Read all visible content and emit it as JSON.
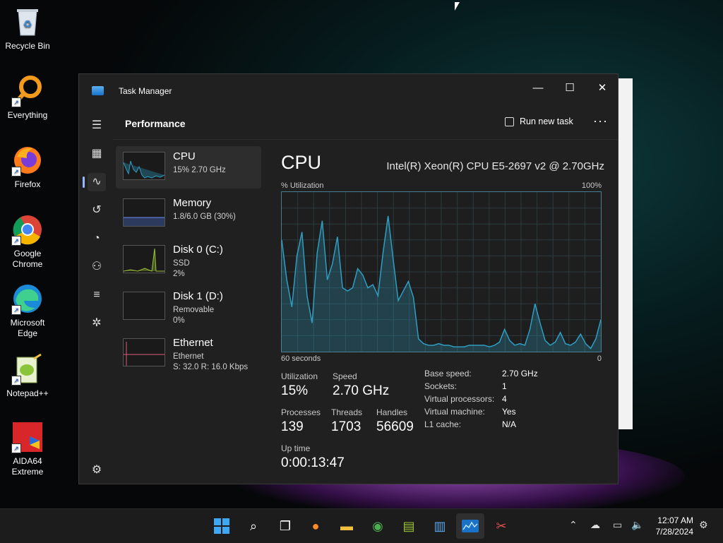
{
  "desktop": {
    "icons": [
      {
        "label": "Recycle Bin"
      },
      {
        "label": "Everything"
      },
      {
        "label": "Firefox"
      },
      {
        "label": "Google Chrome"
      },
      {
        "label": "Microsoft Edge"
      },
      {
        "label": "Notepad++"
      },
      {
        "label": "AIDA64 Extreme"
      }
    ]
  },
  "window": {
    "title": "Task Manager",
    "controls": {
      "minimize": "—",
      "maximize": "☐",
      "close": "✕"
    }
  },
  "header": {
    "page_title": "Performance",
    "run_new_task": "Run new task",
    "more": "···"
  },
  "resources": [
    {
      "name": "CPU",
      "sub1": "15%  2.70 GHz",
      "sub2": ""
    },
    {
      "name": "Memory",
      "sub1": "1.8/6.0 GB (30%)",
      "sub2": ""
    },
    {
      "name": "Disk 0 (C:)",
      "sub1": "SSD",
      "sub2": "2%"
    },
    {
      "name": "Disk 1 (D:)",
      "sub1": "Removable",
      "sub2": "0%"
    },
    {
      "name": "Ethernet",
      "sub1": "Ethernet",
      "sub2": "S: 32.0  R: 16.0 Kbps"
    }
  ],
  "detail": {
    "title": "CPU",
    "cpu_name": "Intel(R) Xeon(R) CPU E5-2697 v2 @ 2.70GHz",
    "graph_label_left": "% Utilization",
    "graph_label_right": "100%",
    "graph_bottom_left": "60 seconds",
    "graph_bottom_right": "0",
    "utilization_label": "Utilization",
    "utilization": "15%",
    "speed_label": "Speed",
    "speed": "2.70 GHz",
    "processes_label": "Processes",
    "processes": "139",
    "threads_label": "Threads",
    "threads": "1703",
    "handles_label": "Handles",
    "handles": "56609",
    "uptime_label": "Up time",
    "uptime": "0:00:13:47",
    "specs": [
      {
        "k": "Base speed:",
        "v": "2.70 GHz"
      },
      {
        "k": "Sockets:",
        "v": "1"
      },
      {
        "k": "Virtual processors:",
        "v": "4"
      },
      {
        "k": "Virtual machine:",
        "v": "Yes"
      },
      {
        "k": "L1 cache:",
        "v": "N/A"
      }
    ],
    "cpu_history": [
      70,
      45,
      28,
      60,
      75,
      35,
      18,
      62,
      82,
      45,
      55,
      72,
      40,
      38,
      40,
      52,
      48,
      40,
      42,
      35,
      62,
      85,
      58,
      32,
      38,
      44,
      34,
      8,
      5,
      4,
      4,
      5,
      4,
      4,
      3,
      3,
      3,
      4,
      4,
      4,
      4,
      3,
      4,
      6,
      14,
      7,
      4,
      5,
      4,
      14,
      30,
      18,
      7,
      4,
      6,
      12,
      5,
      4,
      6,
      11,
      5,
      2,
      8,
      20
    ],
    "graph_color": "#2f9ec2"
  },
  "taskbar": {
    "clock_time": "12:07 AM",
    "clock_date": "7/28/2024"
  }
}
